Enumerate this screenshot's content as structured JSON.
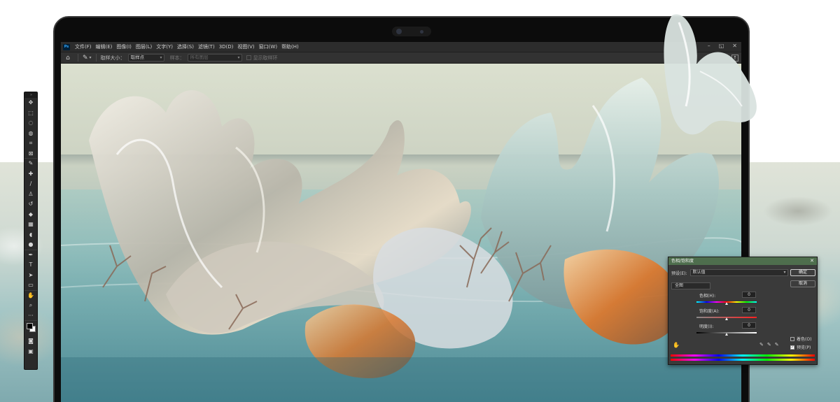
{
  "app": {
    "logo": "Ps",
    "menu": [
      "文件(F)",
      "编辑(E)",
      "图像(I)",
      "图层(L)",
      "文字(Y)",
      "选择(S)",
      "滤镜(T)",
      "3D(D)",
      "视图(V)",
      "窗口(W)",
      "帮助(H)"
    ],
    "window_controls": [
      "–",
      "◱",
      "✕"
    ]
  },
  "options_bar": {
    "sample_size_label": "取样大小：",
    "sample_size_value": "取样点",
    "sample_label": "样本：",
    "sample_value": "所有图层",
    "show_ring_label": "显示取样环"
  },
  "toolbar": {
    "grip": "»",
    "tools": [
      {
        "name": "move-tool",
        "glyph": "✥"
      },
      {
        "name": "marquee-tool",
        "glyph": "⬚"
      },
      {
        "name": "lasso-tool",
        "glyph": "◌"
      },
      {
        "name": "quick-select-tool",
        "glyph": "◍"
      },
      {
        "name": "crop-tool",
        "glyph": "⌗"
      },
      {
        "name": "frame-tool",
        "glyph": "⊠"
      },
      {
        "name": "eyedropper-tool",
        "glyph": "✎"
      },
      {
        "name": "healing-tool",
        "glyph": "✚"
      },
      {
        "name": "brush-tool",
        "glyph": "∕"
      },
      {
        "name": "stamp-tool",
        "glyph": "♙"
      },
      {
        "name": "history-brush-tool",
        "glyph": "↺"
      },
      {
        "name": "eraser-tool",
        "glyph": "◆"
      },
      {
        "name": "gradient-tool",
        "glyph": "▦"
      },
      {
        "name": "blur-tool",
        "glyph": "◖"
      },
      {
        "name": "dodge-tool",
        "glyph": "●"
      },
      {
        "name": "pen-tool",
        "glyph": "✒"
      },
      {
        "name": "type-tool",
        "glyph": "T"
      },
      {
        "name": "path-select-tool",
        "glyph": "➤"
      },
      {
        "name": "shape-tool",
        "glyph": "▭"
      },
      {
        "name": "hand-tool",
        "glyph": "✋"
      },
      {
        "name": "zoom-tool",
        "glyph": "⌕"
      },
      {
        "name": "more-tools",
        "glyph": "···"
      }
    ],
    "bottom": [
      {
        "name": "quick-mask",
        "glyph": "◙"
      },
      {
        "name": "screen-mode",
        "glyph": "▣"
      }
    ]
  },
  "dialog": {
    "title": "色相/饱和度",
    "close": "✕",
    "preset_label": "预设(E):",
    "preset_value": "默认值",
    "ok_label": "确定",
    "cancel_label": "取消",
    "channel": "全图",
    "hue_label": "色相(H):",
    "hue_value": "0",
    "sat_label": "饱和度(A):",
    "sat_value": "0",
    "light_label": "明度(I):",
    "light_value": "0",
    "colorize_label": "着色(O)",
    "preview_label": "预览(P)",
    "preview_checked": "✓"
  },
  "colors": {
    "dialog_title_bar": "#4e6e4d",
    "ps_blue": "#31a8ff"
  }
}
